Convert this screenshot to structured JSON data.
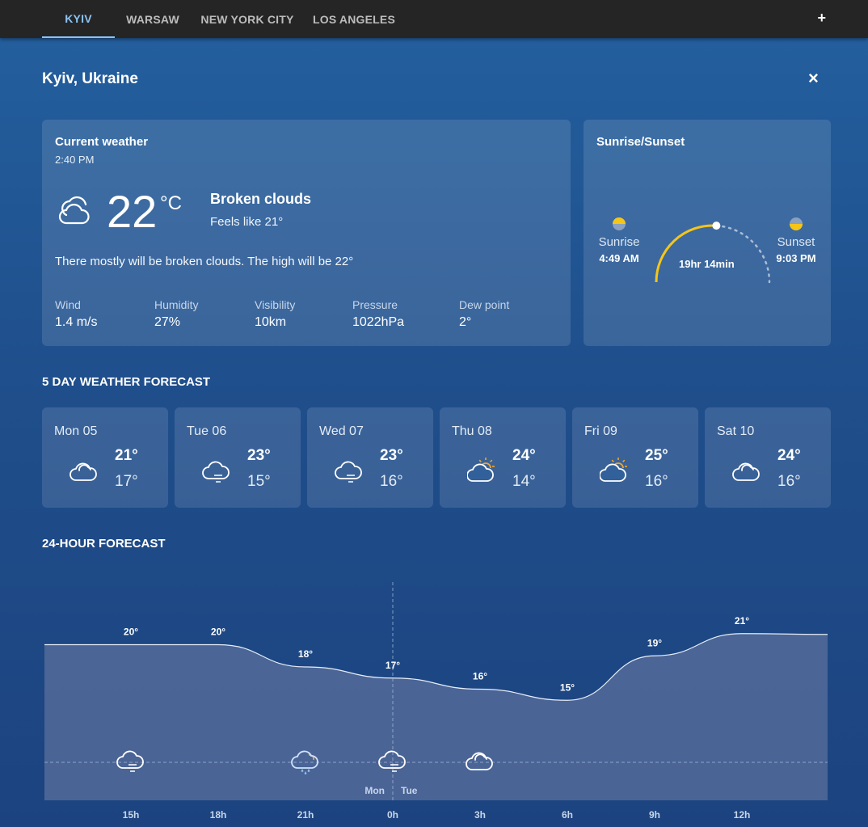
{
  "tabs": [
    {
      "label": "KYIV",
      "active": true
    },
    {
      "label": "WARSAW",
      "active": false
    },
    {
      "label": "NEW YORK CITY",
      "active": false
    },
    {
      "label": "LOS ANGELES",
      "active": false
    }
  ],
  "add_label": "+",
  "close_label": "×",
  "location": "Kyiv, Ukraine",
  "current": {
    "title": "Current weather",
    "time": "2:40 PM",
    "temp": "22",
    "unit": "°C",
    "condition": "Broken clouds",
    "feels_like": "Feels like  21°",
    "description": "There mostly will be broken clouds. The high will be 22°",
    "icon": "broken-clouds-icon",
    "metrics": [
      {
        "label": "Wind",
        "value": "1.4 m/s"
      },
      {
        "label": "Humidity",
        "value": "27%"
      },
      {
        "label": "Visibility",
        "value": "10km"
      },
      {
        "label": "Pressure",
        "value": "1022hPa"
      },
      {
        "label": "Dew point",
        "value": "2°"
      }
    ]
  },
  "sun": {
    "title": "Sunrise/Sunset",
    "sunrise_label": "Sunrise",
    "sunrise_time": "4:49 AM",
    "sunset_label": "Sunset",
    "sunset_time": "9:03 PM",
    "day_length": "19hr 14min",
    "day_elapsed_fraction": 0.52
  },
  "forecast_title": "5 DAY WEATHER FORECAST",
  "forecast": [
    {
      "day": "Mon 05",
      "high": "21°",
      "low": "17°",
      "icon": "cloud-icon"
    },
    {
      "day": "Tue 06",
      "high": "23°",
      "low": "15°",
      "icon": "fog-cloud-icon"
    },
    {
      "day": "Wed 07",
      "high": "23°",
      "low": "16°",
      "icon": "fog-cloud-icon"
    },
    {
      "day": "Thu 08",
      "high": "24°",
      "low": "14°",
      "icon": "sun-cloud-icon"
    },
    {
      "day": "Fri 09",
      "high": "25°",
      "low": "16°",
      "icon": "sun-cloud-icon"
    },
    {
      "day": "Sat 10",
      "high": "24°",
      "low": "16°",
      "icon": "cloud-icon"
    }
  ],
  "hourly_title": "24-HOUR FORECAST",
  "chart_data": {
    "type": "area",
    "title": "24-HOUR FORECAST",
    "x": [
      "15h",
      "18h",
      "21h",
      "0h",
      "3h",
      "6h",
      "9h",
      "12h"
    ],
    "series": [
      {
        "values": [
          20,
          20,
          18,
          17,
          16,
          15,
          19,
          21
        ]
      }
    ],
    "point_labels": [
      "20°",
      "20°",
      "18°",
      "17°",
      "16°",
      "15°",
      "19°",
      "21°"
    ],
    "icons": [
      "fog-cloud-icon",
      null,
      "rain-sun-cloud-icon",
      "fog-cloud-icon",
      "cloud-icon",
      null,
      null,
      null
    ],
    "day_divider": {
      "before": "Mon",
      "after": "Tue"
    },
    "ylim": [
      10,
      24
    ],
    "grid": false,
    "colors": {
      "line": "#e8eef7",
      "fill": "#5a6f9c",
      "accent": "#f5c518"
    }
  }
}
